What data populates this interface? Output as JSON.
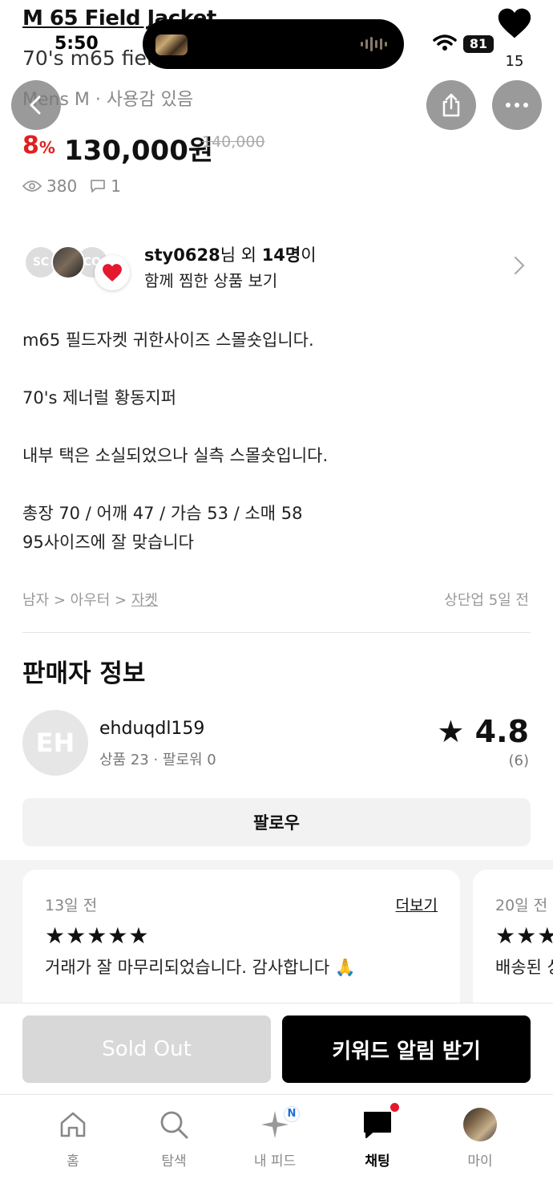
{
  "status_bar": {
    "time": "5:50",
    "battery": "81"
  },
  "product": {
    "title": "M 65 Field Jacket",
    "subtitle": "70's m65 field j",
    "meta": "Mens M · 사용감 있음",
    "discount_value": "8",
    "discount_unit": "%",
    "price": "130,000원",
    "original_price": "140,000",
    "views": "380",
    "comments": "1",
    "likes": "15"
  },
  "likers": {
    "avatar1": "SC",
    "avatar3": "CO",
    "user": "sty0628",
    "suffix1": "님 외 ",
    "count": "14명",
    "suffix2": "이",
    "line2": "함께 찜한 상품 보기"
  },
  "description": [
    "m65 필드자켓 귀한사이즈 스몰숏입니다.",
    "70's 제너럴 황동지퍼",
    "내부 택은 소실되었으나 실측 스몰숏입니다.",
    "총장 70 / 어깨 47 / 가슴 53 / 소매 58\n95사이즈에 잘 맞습니다"
  ],
  "category": {
    "path": "남자 > 아우터 > ",
    "leaf": "자켓"
  },
  "bumped": "상단업 5일 전",
  "seller": {
    "section_title": "판매자 정보",
    "initials": "EH",
    "name": "ehduqdl159",
    "stats": "상품 23 · 팔로워 0",
    "rating": "4.8",
    "rating_count": "(6)",
    "follow_label": "팔로우"
  },
  "reviews": [
    {
      "date": "13일 전",
      "more": "더보기",
      "stars": "★★★★★",
      "text": "거래가 잘 마무리되었습니다. 감사합니다 🙏"
    },
    {
      "date": "20일 전",
      "more": "",
      "stars": "★★★",
      "text": "배송된 상"
    }
  ],
  "cta": {
    "sold_out": "Sold Out",
    "keyword_alert": "키워드 알림 받기"
  },
  "tabs": [
    {
      "label": "홈",
      "icon": "home-icon"
    },
    {
      "label": "탐색",
      "icon": "search-icon"
    },
    {
      "label": "내 피드",
      "icon": "sparkle-icon",
      "badge": "N"
    },
    {
      "label": "채팅",
      "icon": "chat-icon"
    },
    {
      "label": "마이",
      "icon": "avatar-icon"
    }
  ],
  "colors": {
    "discount": "#e02020",
    "primary_button": "#000000",
    "disabled_button": "#d8d8d8",
    "notification_dot": "#e5192d"
  }
}
